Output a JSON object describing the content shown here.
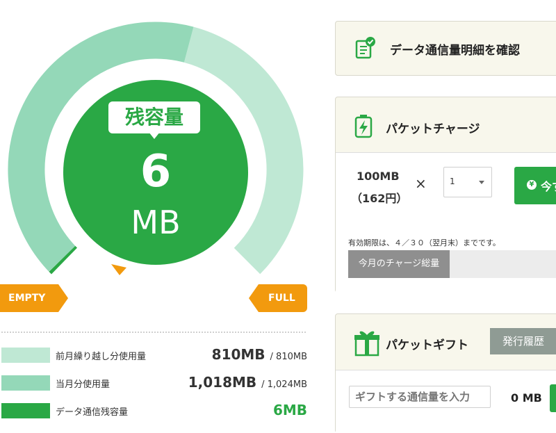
{
  "gauge": {
    "title": "残容量",
    "value": "6",
    "unit": "MB",
    "empty_label": "EMPTY",
    "full_label": "FULL",
    "prev_used_fraction": 0.445,
    "curr_used_fraction": 0.55,
    "remaining_fraction": 0.005
  },
  "legend": [
    {
      "label": "前月繰り越し分使用量",
      "value": "810MB",
      "total": "/ 810MB",
      "color": "#bfe8d4"
    },
    {
      "label": "当月分使用量",
      "value": "1,018MB",
      "total": "/ 1,024MB",
      "color": "#94d8b8"
    },
    {
      "label": "データ通信残容量",
      "value": "6MB",
      "total": "",
      "color": "#2aa845"
    }
  ],
  "detail_card": {
    "title": "データ通信量明細を確認",
    "icon": "document-check-icon"
  },
  "charge_card": {
    "title": "パケットチャージ",
    "icon": "battery-charge-icon",
    "amount": "100MB",
    "price": "（162円）",
    "times": "×",
    "quantity": "1",
    "button_label": "今すぐ",
    "validity": "有効期限は、４／３０（翌月末）までです。",
    "total_label": "今月のチャージ総量"
  },
  "gift_card": {
    "title": "パケットギフト",
    "icon": "gift-box-icon",
    "history_label": "発行履歴",
    "input_placeholder": "ギフトする通信量を入力",
    "mb_label": "0 MB"
  },
  "colors": {
    "accent": "#2aa845",
    "orange": "#f29a0e"
  }
}
